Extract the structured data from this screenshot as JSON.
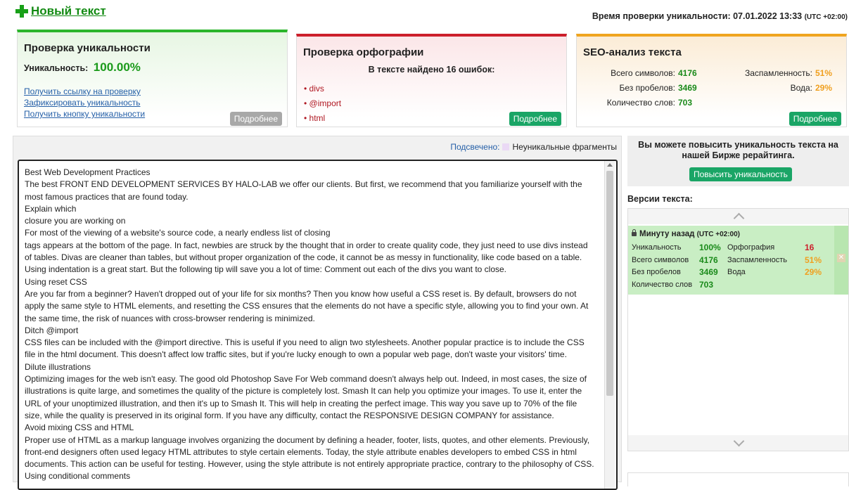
{
  "header": {
    "new_text_label": "Новый текст",
    "check_time": "Время проверки уникальности: 07.01.2022 13:33",
    "timezone": "(UTC +02:00)"
  },
  "uniqueness_card": {
    "title": "Проверка уникальности",
    "uniqueness_label": "Уникальность:",
    "uniqueness_value": "100.00%",
    "links": [
      "Получить ссылку на проверку",
      "Зафиксировать уникальность",
      "Получить кнопку уникальности"
    ],
    "more_label": "Подробнее"
  },
  "spelling_card": {
    "title": "Проверка орфографии",
    "errors_found": "В тексте найдено 16 ошибок:",
    "errors": [
      "divs",
      "@import",
      "html"
    ],
    "more_label": "Подробнее"
  },
  "seo_card": {
    "title": "SEO-анализ текста",
    "total_chars_label": "Всего символов:",
    "total_chars": "4176",
    "no_spaces_label": "Без пробелов:",
    "no_spaces": "3469",
    "word_count_label": "Количество слов:",
    "word_count": "703",
    "spam_label": "Заспамленность:",
    "spam": "51%",
    "water_label": "Вода:",
    "water": "29%",
    "more_label": "Подробнее"
  },
  "text_panel": {
    "highlight_label": "Подсвечено:",
    "legend_text": "Неуникальные фрагменты",
    "paragraphs": [
      "Best Web Development Practices",
      "The best FRONT END DEVELOPMENT SERVICES BY HALO-LAB we offer our clients. But first, we recommend that you familiarize yourself with the most famous practices that are found today.",
      "Explain which",
      "closure you are working on",
      "For most of the viewing of a website's source code, a nearly endless list of closing",
      "tags appears at the bottom of the page. In fact, newbies are struck by the thought that in order to create quality code, they just need to use divs instead of tables. Divas are cleaner than tables, but without proper organization of the code, it cannot be as messy in functionality, like code based on a table. Using indentation is a great start. But the following tip will save you a lot of time: Comment out each of the divs you want to close.",
      "Using reset CSS",
      "Are you far from a beginner? Haven't dropped out of your life for six months? Then you know how useful a CSS reset is. By default, browsers do not apply the same style to HTML elements, and resetting the CSS ensures that the elements do not have a specific style, allowing you to find your own. At the same time, the risk of nuances with cross-browser rendering is minimized.",
      "Ditch @import",
      "CSS files can be included with the @import directive. This is useful if you need to align two stylesheets. Another popular practice is to include the CSS file in the html document. This doesn't affect low traffic sites, but if you're lucky enough to own a popular web page, don't waste your visitors' time.",
      "Dilute illustrations",
      "Optimizing images for the web isn't easy. The good old Photoshop Save For Web command doesn't always help out. Indeed, in most cases, the size of illustrations is quite large, and sometimes the quality of the picture is completely lost. Smash It can help you optimize your images. To use it, enter the URL of your unoptimized illustration, and then it's up to Smash It. This will help in creating the perfect image. This way you save up to 70% of the file size, while the quality is preserved in its original form. If you have any difficulty, contact the RESPONSIVE DESIGN COMPANY for assistance.",
      "Avoid mixing CSS and HTML",
      "Proper use of HTML as a markup language involves organizing the document by defining a header, footer, lists, quotes, and other elements. Previously, front-end designers often used legacy HTML attributes to style certain elements. Today, the style attribute enables developers to embed CSS in html documents. This action can be useful for testing. However, using the style attribute is not entirely appropriate practice, contrary to the philosophy of CSS.",
      "Using conditional comments"
    ]
  },
  "promo": {
    "text": "Вы можете повысить уникальность текста на нашей Бирже рерайтинга.",
    "button_label": "Повысить уникальность"
  },
  "versions": {
    "title": "Версии текста:",
    "item": {
      "time": "Минуту назад",
      "timezone": "(UTC +02:00)",
      "uniqueness_label": "Уникальность",
      "uniqueness": "100%",
      "spelling_label": "Орфография",
      "spelling": "16",
      "total_chars_label": "Всего символов",
      "total_chars": "4176",
      "spam_label": "Заспамленность",
      "spam": "51%",
      "no_spaces_label": "Без пробелов",
      "no_spaces": "3469",
      "water_label": "Вода",
      "water": "29%",
      "words_label": "Количество слов",
      "words": "703",
      "delete_glyph": "✕"
    }
  }
}
